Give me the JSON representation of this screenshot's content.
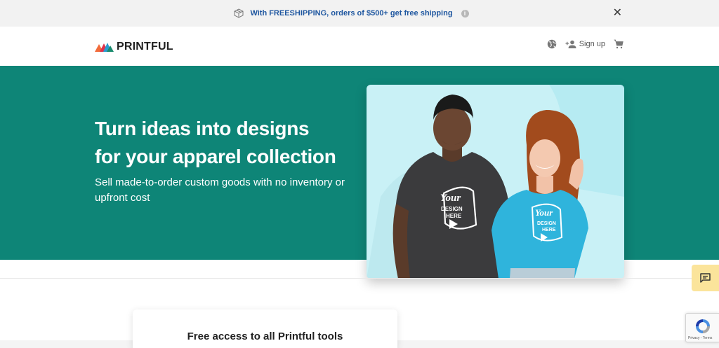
{
  "promo": {
    "text": "With FREESHIPPING, orders of $500+ get free shipping",
    "info_glyph": "i",
    "close_glyph": "✕",
    "text_color": "#1f57a0"
  },
  "header": {
    "logo_text": "PRINTFUL",
    "signup_label": "Sign up"
  },
  "hero": {
    "title_line1": "Turn ideas into designs",
    "title_line2": "for your apparel collection",
    "subtitle": "Sell made-to-order custom goods with no inventory or upfront cost",
    "background": "#0e8577",
    "image": {
      "shirt_text_big": "Your",
      "shirt_text_line2": "DESIGN",
      "shirt_text_line3": "HERE"
    }
  },
  "tools_card": {
    "title": "Free access to all Printful tools"
  },
  "recaptcha": {
    "text": "Privacy - Terms"
  },
  "icons": [
    "box-icon",
    "info-icon",
    "close-icon",
    "logo-mark-icon",
    "globe-icon",
    "add-person-icon",
    "cart-icon",
    "chat-icon",
    "recaptcha-icon"
  ]
}
